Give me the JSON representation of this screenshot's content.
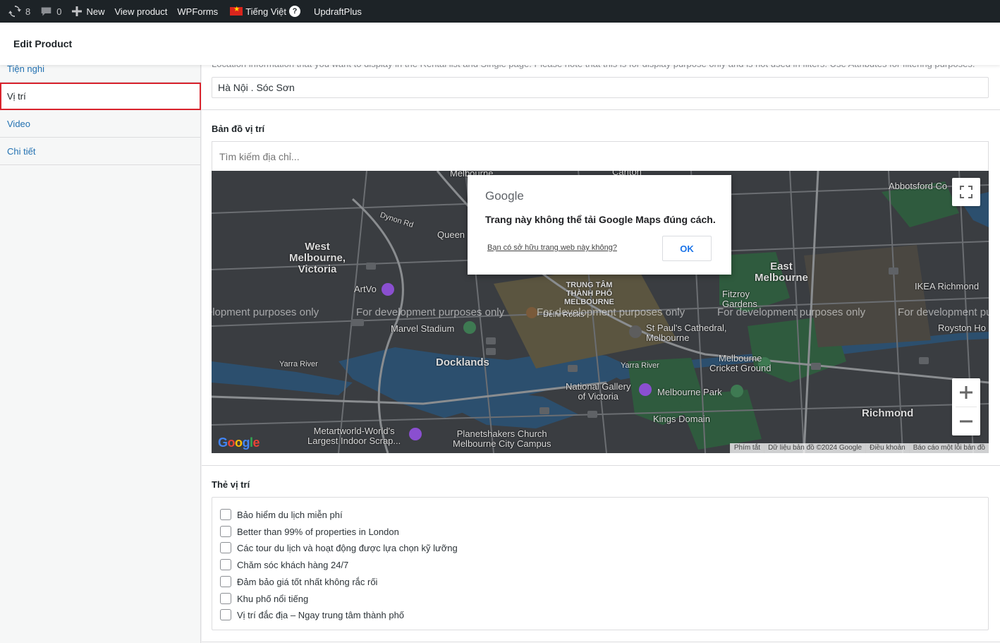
{
  "admin_bar": {
    "updates_count": "8",
    "comments_count": "0",
    "new_label": "New",
    "view_product_label": "View product",
    "wpforms_label": "WPForms",
    "language_label": "Tiếng Việt",
    "help_badge": "?",
    "updraft_label": "UpdraftPlus"
  },
  "header": {
    "title": "Edit Product"
  },
  "sidebar": {
    "items": [
      {
        "label": "Tiện nghi"
      },
      {
        "label": "Vị trí"
      },
      {
        "label": "Video"
      },
      {
        "label": "Chi tiết"
      }
    ]
  },
  "location": {
    "description": "Location information that you want to display in the Rental list and Single page. Please note that this is for display purpose only and is not used in filters. Use Attributes for filtering purposes.",
    "address_value": "Hà Nội . Sóc Sơn"
  },
  "map": {
    "label": "Bản đồ vị trí",
    "search_placeholder": "Tìm kiếm địa chỉ...",
    "dev_watermark": "For development purposes only",
    "dialog": {
      "logo": "Google",
      "message": "Trang này không thể tải Google Maps đúng cách.",
      "owner_link": "Bạn có sở hữu trang web này không?",
      "ok_label": "OK"
    },
    "places": {
      "west_melbourne": "West\nMelbourne,\nVictoria",
      "east_melbourne": "East\nMelbourne",
      "docklands": "Docklands",
      "richmond": "Richmond",
      "cbd": "TRUNG TÂM\nTHÀNH PHỐ\nMELBOURNE",
      "marvel_stadium": "Marvel Stadium",
      "st_pauls": "St Paul's Cathedral,\nMelbourne",
      "cricket_ground": "Melbourne\nCricket Ground",
      "ngv": "National Gallery\nof Victoria",
      "melbourne_park": "Melbourne Park",
      "kings_domain": "Kings Domain",
      "planetshakers": "Planetshakers Church\nMelbourne City Campus",
      "metartworld": "Metartworld-World's\nLargest Indoor Scrap...",
      "fitzroy_gardens": "Fitzroy\nGardens",
      "ikea": "IKEA Richmond",
      "abbotsford": "Abbotsford Co",
      "royston": "Royston Ho",
      "artvo": "ArtVo",
      "queen": "Queen",
      "dynon_rd": "Dynon Rd",
      "yarra_river": "Yarra River",
      "delhi_rocks": "Delhi Rocks",
      "melbourne_top": "Melbourne",
      "carlton": "Carlton"
    },
    "attribution": {
      "shortcuts": "Phím tắt",
      "data": "Dữ liệu bản đồ ©2024 Google",
      "terms": "Điều khoản",
      "report": "Báo cáo một lỗi bản đồ"
    },
    "logo": "Google"
  },
  "tags": {
    "label": "Thẻ vị trí",
    "options": [
      {
        "label": "Bảo hiểm du lịch miễn phí",
        "checked": false
      },
      {
        "label": "Better than 99% of properties in London",
        "checked": false
      },
      {
        "label": "Các tour du lịch và hoạt động được lựa chọn kỹ lưỡng",
        "checked": false
      },
      {
        "label": "Chăm sóc khách hàng 24/7",
        "checked": false
      },
      {
        "label": "Đảm bảo giá tốt nhất không rắc rối",
        "checked": false
      },
      {
        "label": "Khu phố nổi tiếng",
        "checked": false
      },
      {
        "label": "Vị trí đắc địa – Ngay trung tâm thành phố",
        "checked": false
      }
    ]
  }
}
